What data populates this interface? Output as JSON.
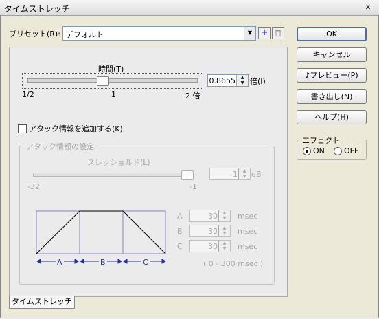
{
  "window": {
    "title": "タイムストレッチ",
    "close_glyph": "✕"
  },
  "preset": {
    "label": "プリセット(R):",
    "value": "デフォルト",
    "add_icon": "plus-icon",
    "delete_icon": "trash-icon"
  },
  "time": {
    "label": "時間(T)",
    "ticks": [
      "1/2",
      "1",
      "2 倍"
    ],
    "value": "0.8655",
    "unit": "倍(I)",
    "slider_fraction": 0.44
  },
  "attack_checkbox": {
    "label": "アタック情報を追加する(K)",
    "checked": false
  },
  "attack_group": {
    "label": "アタック情報の設定",
    "threshold_label": "スレッショルド(L)",
    "threshold_value": "-1",
    "threshold_unit": "dB",
    "range_min": "-32",
    "range_max": "-1",
    "slider_fraction": 1.0,
    "fields": [
      {
        "key": "A",
        "value": "30",
        "unit": "msec"
      },
      {
        "key": "B",
        "value": "30",
        "unit": "msec"
      },
      {
        "key": "C",
        "value": "30",
        "unit": "msec"
      }
    ],
    "range_note": "( 0 - 300 msec )",
    "diagram_labels": [
      "A",
      "B",
      "C"
    ]
  },
  "buttons": {
    "ok": "OK",
    "cancel": "キャンセル",
    "preview": "♪プレビュー(P)",
    "export": "書き出し(N)",
    "help": "ヘルプ(H)"
  },
  "effect": {
    "label": "エフェクト",
    "on": "ON",
    "off": "OFF",
    "selected": "ON"
  },
  "tab": {
    "label": "タイムストレッチ"
  },
  "colors": {
    "diagram_line": "#8080c0",
    "default_button_border": "#4b6ea9"
  }
}
